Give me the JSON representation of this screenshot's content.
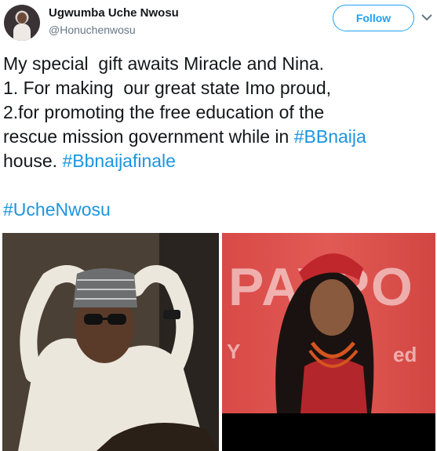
{
  "tweet": {
    "display_name": "Ugwumba Uche Nwosu",
    "handle": "@Honuchenwosu",
    "follow_label": "Follow",
    "lines": [
      [
        {
          "text": "My special  gift awaits Miracle and Nina."
        }
      ],
      [
        {
          "text": "1. For making  our great state Imo proud,"
        }
      ],
      [
        {
          "text": "2.for promoting the free education of the"
        }
      ],
      [
        {
          "text": "rescue mission government while in "
        },
        {
          "text": "#BBnaija",
          "hashtag": true
        }
      ],
      [
        {
          "text": "house. "
        },
        {
          "text": "#Bbnaijafinale",
          "hashtag": true
        }
      ],
      [
        {
          "text": ""
        }
      ],
      [
        {
          "text": "#UcheNwosu",
          "hashtag": true
        }
      ]
    ]
  },
  "media": {
    "right_banner_big": "PAYPO",
    "right_banner_small_left": "Y",
    "right_banner_small_right": "ed"
  },
  "colors": {
    "accent": "#1da1f2",
    "hashtag": "#1b95e0",
    "text": "#14171a",
    "secondary": "#657786"
  },
  "icons": {
    "avatar": "profile-photo",
    "caret": "chevron-down-icon"
  }
}
